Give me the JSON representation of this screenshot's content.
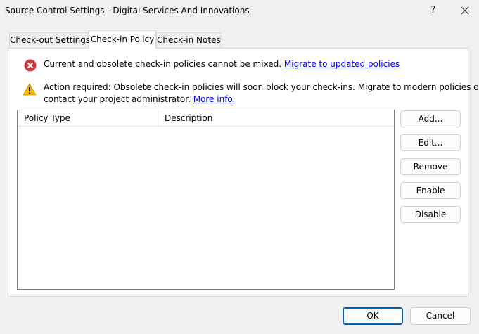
{
  "window": {
    "title": "Source Control Settings - Digital Services And Innovations",
    "help_glyph": "?",
    "close_icon": "close-icon"
  },
  "tabs": [
    {
      "label": "Check-out Settings",
      "active": false
    },
    {
      "label": "Check-in Policy",
      "active": true
    },
    {
      "label": "Check-in Notes",
      "active": false
    }
  ],
  "messages": {
    "error": {
      "icon": "error-icon",
      "text": "Current and obsolete check-in policies cannot be mixed.",
      "link": "Migrate to updated policies"
    },
    "warning": {
      "icon": "warning-icon",
      "line1": "Action required: Obsolete check-in policies will soon block your check-ins. Migrate to modern policies or",
      "line2": "contact your project administrator.",
      "link": "More info."
    }
  },
  "policy_list": {
    "columns": [
      "Policy Type",
      "Description"
    ],
    "rows": []
  },
  "side_buttons": {
    "add": "Add...",
    "edit": "Edit...",
    "remove": "Remove",
    "enable": "Enable",
    "disable": "Disable"
  },
  "footer": {
    "ok": "OK",
    "cancel": "Cancel"
  },
  "colors": {
    "accent": "#005fb8",
    "error": "#d13438",
    "warning": "#f2b705",
    "link": "#0000ee"
  }
}
